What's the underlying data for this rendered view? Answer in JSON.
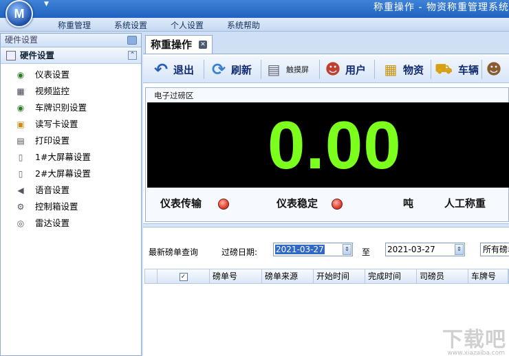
{
  "window": {
    "title": "称重操作 - 物资称重管理系统",
    "orb_letter": "M"
  },
  "menu": [
    "称重管理",
    "系统设置",
    "个人设置",
    "系统帮助"
  ],
  "sidebar": {
    "header": "硬件设置",
    "group": "硬件设置",
    "items": [
      {
        "label": "仪表设置",
        "icon": "gauge-icon"
      },
      {
        "label": "视频监控",
        "icon": "video-icon"
      },
      {
        "label": "车牌识别设置",
        "icon": "plate-recognition-icon"
      },
      {
        "label": "读写卡设置",
        "icon": "card-reader-icon"
      },
      {
        "label": "打印设置",
        "icon": "printer-icon"
      },
      {
        "label": "1#大屏幕设置",
        "icon": "screen-icon"
      },
      {
        "label": "2#大屏幕设置",
        "icon": "screen-icon"
      },
      {
        "label": "语音设置",
        "icon": "speaker-icon"
      },
      {
        "label": "控制箱设置",
        "icon": "control-box-icon"
      },
      {
        "label": "雷达设置",
        "icon": "radar-icon"
      }
    ]
  },
  "tab": {
    "label": "称重操作"
  },
  "toolbar": {
    "exit": "退出",
    "refresh": "刷新",
    "touchscreen": "触摸屏",
    "user": "用户",
    "material": "物资",
    "vehicle": "车辆"
  },
  "scale": {
    "area_label": "电子过磅区",
    "weight": "0.00",
    "meter_transmission": "仪表传输",
    "meter_stable": "仪表稳定",
    "unit": "吨",
    "manual_weigh": "人工称重",
    "colors": {
      "digits": "#7cff1c",
      "led": "#e24a3a"
    }
  },
  "query": {
    "title": "最新磅单查询",
    "date_label": "过磅日期:",
    "date_from": "2021-03-27",
    "to_label": "至",
    "date_to": "2021-03-27",
    "filter_value": "所有磅单"
  },
  "grid": {
    "columns": [
      "磅单号",
      "磅单来源",
      "开始时间",
      "完成时间",
      "司磅员",
      "车牌号"
    ]
  },
  "watermark": {
    "text": "下载吧",
    "url": "www.xiazaiba.com"
  }
}
